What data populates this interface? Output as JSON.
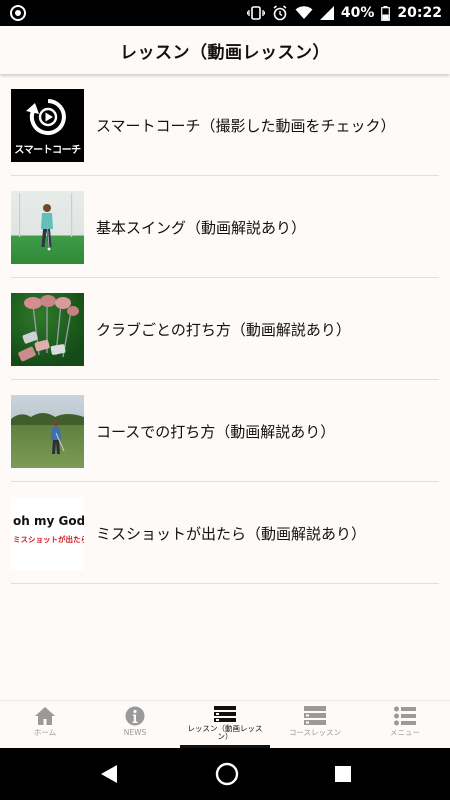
{
  "status_bar": {
    "battery": "40%",
    "time": "20:22",
    "icons": [
      "notification-circle-icon",
      "vibrate-icon",
      "alarm-icon",
      "wifi-icon",
      "signal-icon",
      "battery-icon"
    ]
  },
  "header": {
    "title": "レッスン（動画レッスン）"
  },
  "lessons": [
    {
      "label": "スマートコーチ（撮影した動画をチェック）",
      "thumb_caption": "スマートコーチ"
    },
    {
      "label": "基本スイング（動画解説あり）"
    },
    {
      "label": "クラブごとの打ち方（動画解説あり）"
    },
    {
      "label": "コースでの打ち方（動画解説あり）"
    },
    {
      "label": "ミスショットが出たら（動画解説あり）",
      "thumb_line1": "oh my God!!",
      "thumb_line2": "ミスショットが出たら..."
    }
  ],
  "bottom_nav": [
    {
      "label": "ホーム",
      "icon": "home-icon",
      "active": false
    },
    {
      "label": "NEWS",
      "icon": "info-icon",
      "active": false
    },
    {
      "label": "レッスン（動画レッスン）",
      "icon": "lesson-list-icon",
      "active": true
    },
    {
      "label": "コースレッスン",
      "icon": "course-list-icon",
      "active": false
    },
    {
      "label": "メニュー",
      "icon": "menu-icon",
      "active": false
    }
  ],
  "colors": {
    "background": "#fdfaf8",
    "active_nav": "#111111",
    "inactive_nav": "#9a9a9a",
    "alert_red": "#d0181f"
  }
}
